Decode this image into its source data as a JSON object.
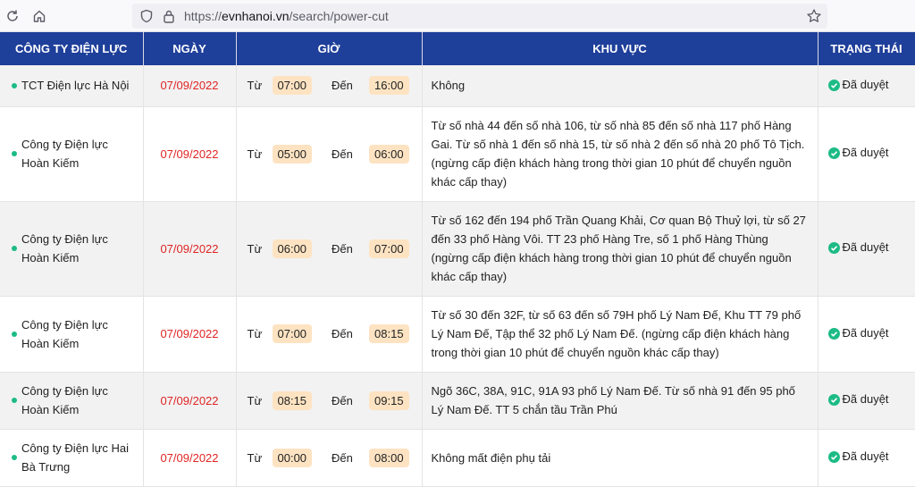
{
  "browser": {
    "url_prefix": "https://",
    "url_host": "evnhanoi.vn",
    "url_path": "/search/power-cut",
    "icons": [
      "refresh-icon",
      "home-icon",
      "shield-icon",
      "lock-icon",
      "star-icon"
    ]
  },
  "table": {
    "headers": [
      "CÔNG TY ĐIỆN LỰC",
      "NGÀY",
      "GIỜ",
      "KHU VỰC",
      "TRẠNG THÁI"
    ],
    "from_label": "Từ",
    "to_label": "Đến",
    "rows": [
      {
        "company": "TCT Điện lực Hà Nội",
        "date": "07/09/2022",
        "from": "07:00",
        "to": "16:00",
        "area": "Không",
        "status": "Đã duyệt"
      },
      {
        "company": "Công ty Điện lực Hoàn Kiếm",
        "date": "07/09/2022",
        "from": "05:00",
        "to": "06:00",
        "area": "Từ số nhà 44 đến số nhà 106, từ số nhà 85 đến số nhà 117 phố Hàng Gai. Từ số nhà 1 đến số nhà 15, từ số nhà 2 đến số nhà 20 phố Tô Tịch. (ngừng cấp điện khách hàng trong thời gian 10 phút để chuyển nguồn khác cấp thay)",
        "status": "Đã duyệt"
      },
      {
        "company": "Công ty Điện lực Hoàn Kiếm",
        "date": "07/09/2022",
        "from": "06:00",
        "to": "07:00",
        "area": "Từ số 162 đến 194 phố Trần Quang Khải, Cơ quan Bộ Thuỷ lợi, từ số 27 đến 33 phố Hàng Vôi. TT 23 phố Hàng Tre, số 1 phố Hàng Thùng (ngừng cấp điện khách hàng trong thời gian 10 phút để chuyển nguồn khác cấp thay)",
        "status": "Đã duyệt"
      },
      {
        "company": "Công ty Điện lực Hoàn Kiếm",
        "date": "07/09/2022",
        "from": "07:00",
        "to": "08:15",
        "area": "Từ số 30 đến 32F, từ số 63 đến số 79H phố Lý Nam Đế, Khu TT 79 phố Lý Nam Đế, Tập thể 32 phố Lý Nam Đế. (ngừng cấp điện khách hàng trong thời gian 10 phút để chuyển nguồn khác cấp thay)",
        "status": "Đã duyệt"
      },
      {
        "company": "Công ty Điện lực Hoàn Kiếm",
        "date": "07/09/2022",
        "from": "08:15",
        "to": "09:15",
        "area": "Ngõ 36C, 38A, 91C, 91A 93 phố Lý Nam Đế. Từ số nhà 91 đến 95 phố Lý Nam Đế. TT 5 chắn tầu Trần Phú",
        "status": "Đã duyệt"
      },
      {
        "company": "Công ty Điện lực Hai Bà Trưng",
        "date": "07/09/2022",
        "from": "00:00",
        "to": "08:00",
        "area": "Không mất điện phụ tải",
        "status": "Đã duyệt"
      }
    ]
  },
  "colors": {
    "header_bg": "#1e3f9a",
    "date": "#e02424",
    "badge": "#fde3c2",
    "status_ok": "#1dbb86"
  }
}
